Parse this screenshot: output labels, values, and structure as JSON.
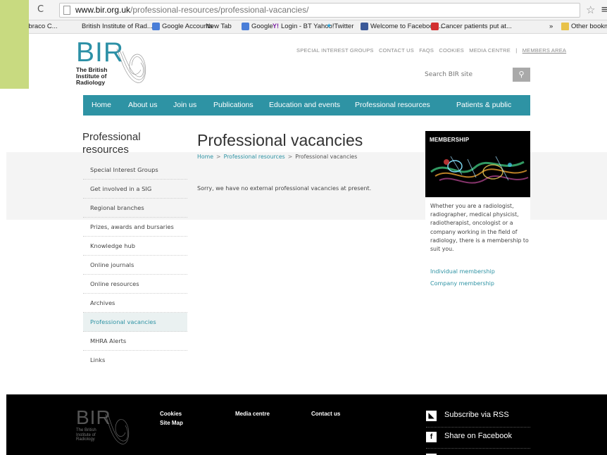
{
  "browser": {
    "url_host": "www.bir.org.uk",
    "url_path": "/professional-resources/professional-vacancies/",
    "bookmarks": [
      {
        "label": "ent - Umbraco C...",
        "icon": "none"
      },
      {
        "label": "British Institute of Rad...",
        "icon": "page"
      },
      {
        "label": "Google Accounts",
        "icon": "google"
      },
      {
        "label": "New Tab",
        "icon": "page"
      },
      {
        "label": "Google",
        "icon": "google"
      },
      {
        "label": "Login - BT Yahoo!",
        "icon": "yahoo"
      },
      {
        "label": "Twitter",
        "icon": "twitter"
      },
      {
        "label": "Welcome to Facebook ...",
        "icon": "fb"
      },
      {
        "label": "Cancer patients put at...",
        "icon": "cancer"
      }
    ],
    "more_chevron": "»",
    "other_bookmarks": "Other bookmarks"
  },
  "logo": {
    "mark": "BIR",
    "line1": "The British",
    "line2": "Institute of",
    "line3": "Radiology"
  },
  "top_links": {
    "items": [
      "SPECIAL INTEREST GROUPS",
      "CONTACT US",
      "FAQS",
      "COOKIES",
      "MEDIA CENTRE"
    ],
    "separator": "|",
    "members": "MEMBERS AREA"
  },
  "search": {
    "placeholder": "Search BIR site"
  },
  "nav": {
    "items": [
      "Home",
      "About us",
      "Join us",
      "Publications",
      "Education and events",
      "Professional resources",
      "Patients & public"
    ]
  },
  "sidebar": {
    "title": "Professional resources",
    "items": [
      "Special Interest Groups",
      "Get involved in a SIG",
      "Regional branches",
      "Prizes, awards and bursaries",
      "Knowledge hub",
      "Online journals",
      "Online resources",
      "Archives",
      "Professional vacancies",
      "MHRA Alerts",
      "Links"
    ],
    "active_index": 8
  },
  "main": {
    "title": "Professional vacancies",
    "breadcrumb": [
      "Home",
      "Professional resources",
      "Professional vacancies"
    ],
    "breadcrumb_separator": ">",
    "message": "Sorry, we have no external professional vacancies at present."
  },
  "promo": {
    "heading": "MEMBERSHIP",
    "body": "Whether you are a radiologist, radiographer, medical physicist, radiotherapist, oncologist or a company working in the field of radiology, there is a membership to suit you.",
    "links": [
      "Individual membership",
      "Company membership"
    ]
  },
  "footer": {
    "logo_mark": "BIR",
    "logo_lines": [
      "The British",
      "Institute of",
      "Radiology"
    ],
    "links": {
      "cookies": "Cookies",
      "sitemap": "Site Map",
      "media": "Media centre",
      "contact": "Contact us"
    },
    "social": [
      {
        "label": "Subscribe via RSS",
        "icon": "rss-icon"
      },
      {
        "label": "Share on Facebook",
        "icon": "facebook-icon"
      }
    ]
  },
  "colors": {
    "accent": "#2e93a4",
    "sidebar_green": "#c8da80",
    "footer": "#000000"
  }
}
